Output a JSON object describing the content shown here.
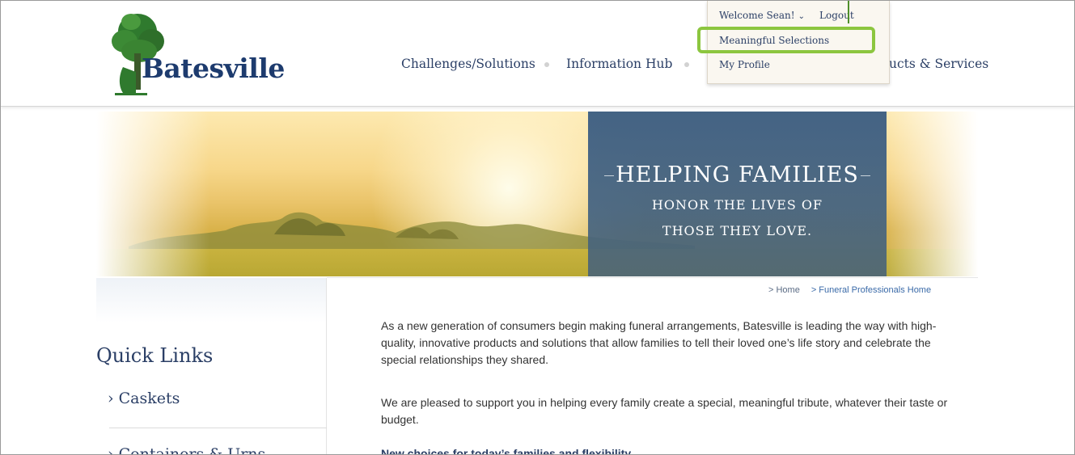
{
  "brand": {
    "logo_text": "Batesville"
  },
  "nav": {
    "items": [
      {
        "label": "Challenges/Solutions"
      },
      {
        "label": "Information Hub"
      },
      {
        "label": "ucts & Services"
      }
    ]
  },
  "user_menu": {
    "welcome": "Welcome Sean!",
    "logout": "Logout",
    "items": [
      {
        "label": "Meaningful Selections"
      },
      {
        "label": "My Profile"
      }
    ]
  },
  "hero": {
    "line1": "HELPING FAMILIES",
    "line2": "HONOR THE LIVES OF",
    "line3": "THOSE THEY LOVE."
  },
  "breadcrumb": {
    "home": "> Home",
    "current": "> Funeral Professionals Home"
  },
  "quick_links": {
    "title": "Quick Links",
    "items": [
      {
        "label": "› Caskets"
      },
      {
        "label": "› Containers & Urns"
      }
    ]
  },
  "content": {
    "paragraph1": "As a new generation of consumers begin making funeral arrangements, Batesville is leading the way with high-quality, innovative products and solutions that allow families to tell their loved one’s life story and celebrate the special relationships they shared.",
    "paragraph2": "We are pleased to support you in helping every family create a special, meaningful tribute, whatever their taste or budget.",
    "heading_partial": "New choices for today’s families and flexibility"
  },
  "colors": {
    "navy": "#2b3f66",
    "highlight": "#8cc63f",
    "link": "#3a6aa8"
  }
}
